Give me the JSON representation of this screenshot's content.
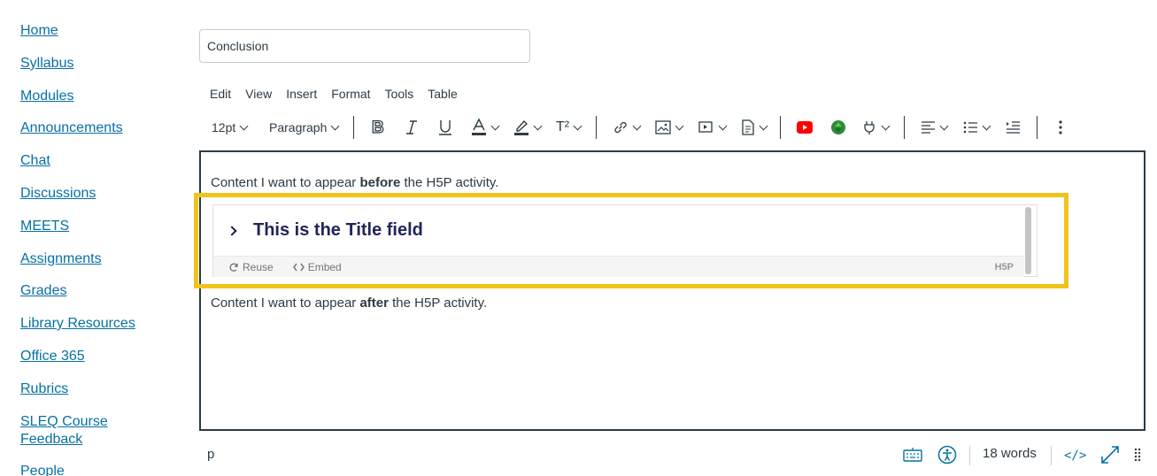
{
  "nav": {
    "items": [
      {
        "label": "Home"
      },
      {
        "label": "Syllabus"
      },
      {
        "label": "Modules"
      },
      {
        "label": "Announcements"
      },
      {
        "label": "Chat"
      },
      {
        "label": "Discussions"
      },
      {
        "label": "MEETS"
      },
      {
        "label": "Assignments"
      },
      {
        "label": "Grades"
      },
      {
        "label": "Library Resources"
      },
      {
        "label": "Office 365"
      },
      {
        "label": "Rubrics"
      },
      {
        "label": "SLEQ Course"
      },
      {
        "label": "Feedback"
      },
      {
        "label": "People"
      }
    ]
  },
  "page_title": {
    "value": "Conclusion"
  },
  "menubar": {
    "items": [
      "Edit",
      "View",
      "Insert",
      "Format",
      "Tools",
      "Table"
    ]
  },
  "toolbar": {
    "font_size": "12pt",
    "block_format": "Paragraph",
    "superscript_label": "T²"
  },
  "editor": {
    "before": {
      "pre": "Content I want to appear ",
      "bold": "before",
      "post": " the H5P activity."
    },
    "after": {
      "pre": "Content I want to appear ",
      "bold": "after",
      "post": " the H5P activity."
    },
    "h5p": {
      "title": "This is the Title field",
      "reuse_label": "Reuse",
      "embed_label": "Embed",
      "logo": "H5P"
    }
  },
  "statusbar": {
    "path": "p",
    "word_count": "18 words",
    "html_toggle": "</>"
  },
  "colors": {
    "link": "#0770a3",
    "highlight": "#f0c419",
    "h5p_title": "#212558",
    "youtube": "#ff0000",
    "accent": "#0770a3"
  }
}
